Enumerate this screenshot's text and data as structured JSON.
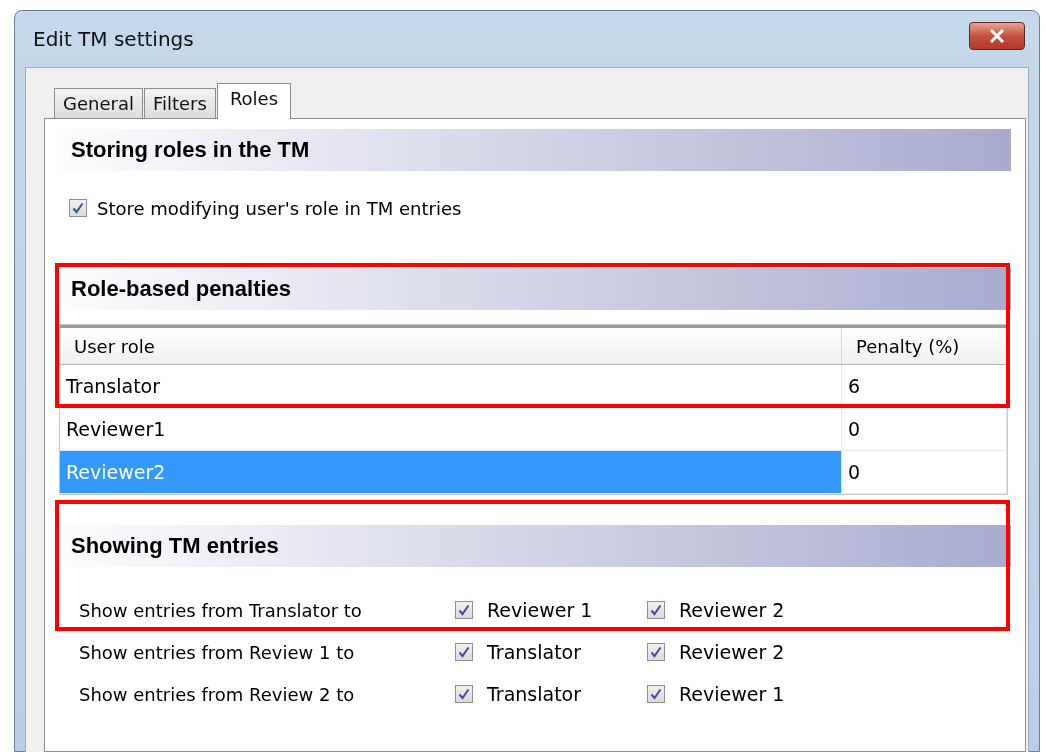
{
  "window": {
    "title": "Edit TM settings"
  },
  "tabs": [
    {
      "label": "General",
      "selected": false
    },
    {
      "label": "Filters",
      "selected": false
    },
    {
      "label": "Roles",
      "selected": true
    }
  ],
  "storing": {
    "heading": "Storing roles in the TM",
    "checkbox": {
      "label": "Store modifying user's role in TM entries",
      "checked": true
    }
  },
  "penalties": {
    "heading": "Role-based penalties",
    "highlighted": true,
    "columns": [
      "User role",
      "Penalty (%)"
    ],
    "rows": [
      {
        "role": "Translator",
        "penalty": "6",
        "selected": false,
        "highlighted": true
      },
      {
        "role": "Reviewer1",
        "penalty": "0",
        "selected": false,
        "highlighted": false
      },
      {
        "role": "Reviewer2",
        "penalty": "0",
        "selected": true,
        "highlighted": false
      }
    ]
  },
  "showing": {
    "heading": "Showing TM entries",
    "highlighted": true,
    "rows": [
      {
        "label": "Show entries from Translator to",
        "highlighted": true,
        "options": [
          {
            "label": "Reviewer 1",
            "checked": true
          },
          {
            "label": "Reviewer 2",
            "checked": true
          }
        ]
      },
      {
        "label": "Show entries from Review 1 to",
        "highlighted": false,
        "options": [
          {
            "label": "Translator",
            "checked": true
          },
          {
            "label": "Reviewer 2",
            "checked": true
          }
        ]
      },
      {
        "label": "Show entries from Review 2 to",
        "highlighted": false,
        "options": [
          {
            "label": "Translator",
            "checked": true
          },
          {
            "label": "Reviewer 1",
            "checked": true
          }
        ]
      }
    ]
  }
}
